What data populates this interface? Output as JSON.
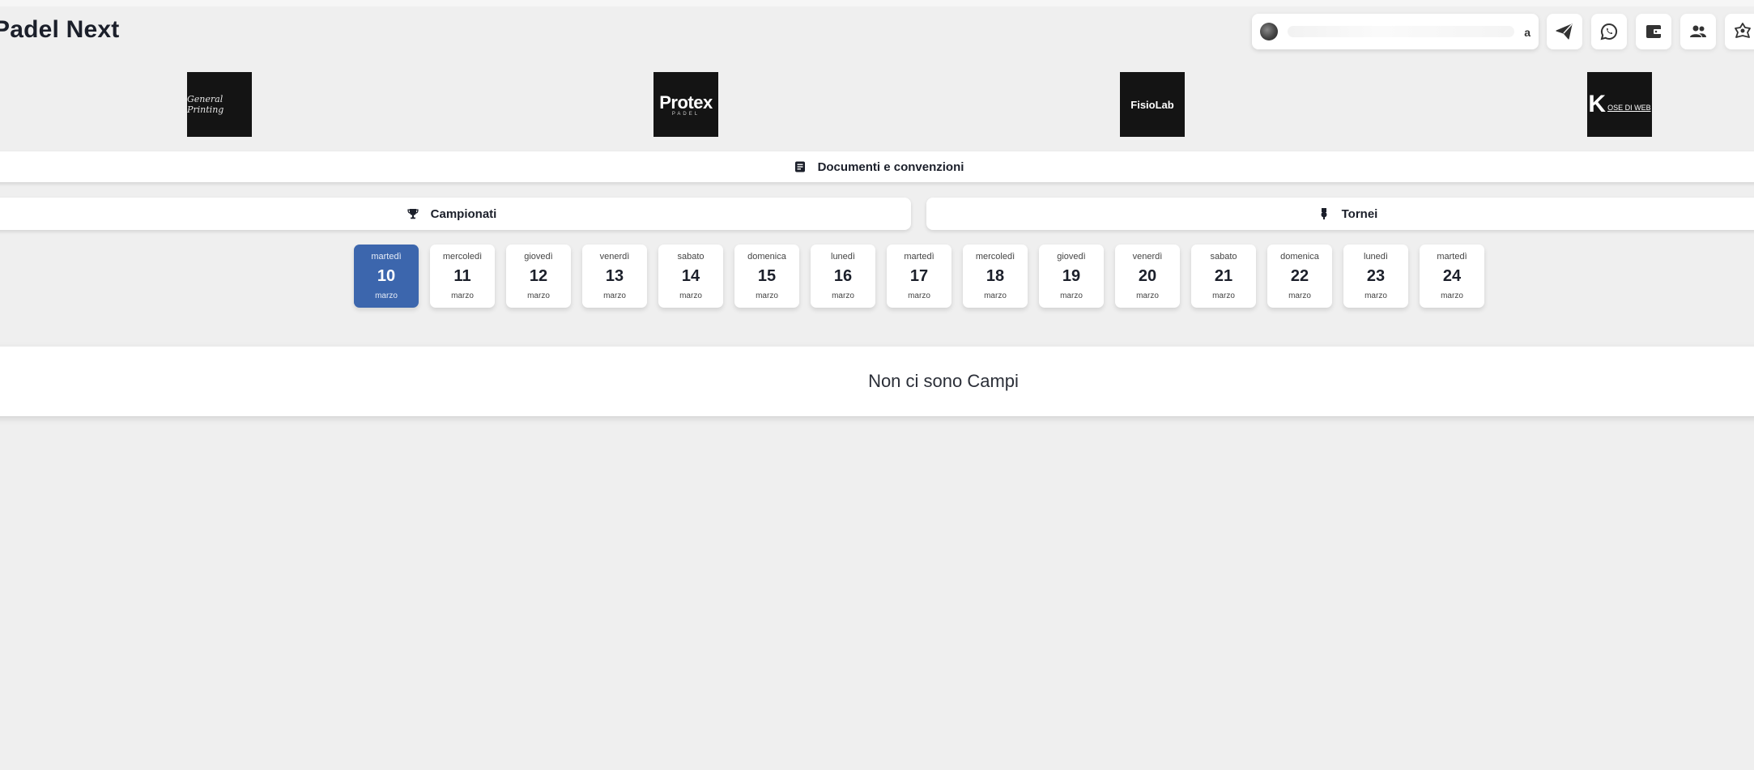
{
  "header": {
    "app_title": "Padel Next",
    "user_suffix": "a"
  },
  "toolbar_icons": [
    "send-icon",
    "whatsapp-icon",
    "wallet-icon",
    "users-icon",
    "settings-icon"
  ],
  "sponsors": [
    {
      "name": "General Printing"
    },
    {
      "name": "Protex",
      "sub": "PADEL"
    },
    {
      "name": "FisioLab"
    },
    {
      "mark": "K",
      "name": "OSE DI WEB"
    }
  ],
  "nav": {
    "documents_label": "Documenti e convenzioni",
    "championships_label": "Campionati",
    "tournaments_label": "Tornei"
  },
  "dates": [
    {
      "dow": "martedì",
      "day": "10",
      "month": "marzo",
      "selected": true
    },
    {
      "dow": "mercoledì",
      "day": "11",
      "month": "marzo"
    },
    {
      "dow": "giovedì",
      "day": "12",
      "month": "marzo"
    },
    {
      "dow": "venerdì",
      "day": "13",
      "month": "marzo"
    },
    {
      "dow": "sabato",
      "day": "14",
      "month": "marzo"
    },
    {
      "dow": "domenica",
      "day": "15",
      "month": "marzo"
    },
    {
      "dow": "lunedì",
      "day": "16",
      "month": "marzo"
    },
    {
      "dow": "martedì",
      "day": "17",
      "month": "marzo"
    },
    {
      "dow": "mercoledì",
      "day": "18",
      "month": "marzo"
    },
    {
      "dow": "giovedì",
      "day": "19",
      "month": "marzo"
    },
    {
      "dow": "venerdì",
      "day": "20",
      "month": "marzo"
    },
    {
      "dow": "sabato",
      "day": "21",
      "month": "marzo"
    },
    {
      "dow": "domenica",
      "day": "22",
      "month": "marzo"
    },
    {
      "dow": "lunedì",
      "day": "23",
      "month": "marzo"
    },
    {
      "dow": "martedì",
      "day": "24",
      "month": "marzo"
    }
  ],
  "empty_message": "Non ci sono Campi",
  "colors": {
    "accent": "#3c66ad",
    "background": "#efefef",
    "sponsor_bg": "#141414"
  }
}
